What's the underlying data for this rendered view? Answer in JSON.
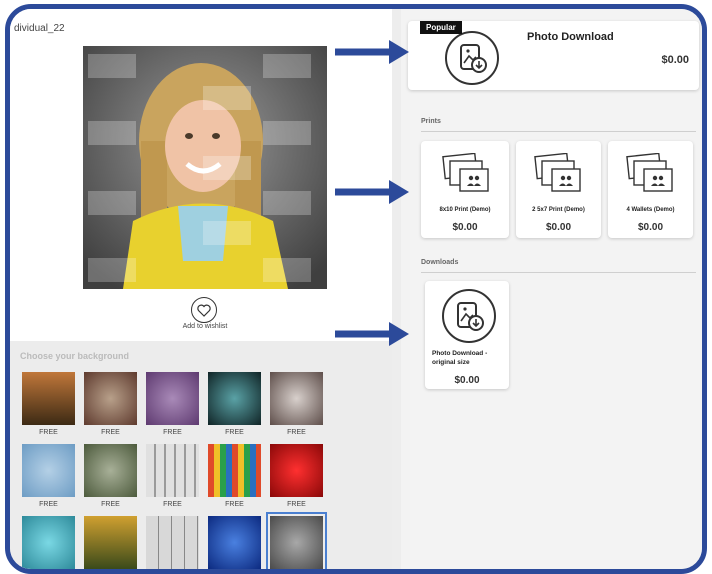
{
  "file_name": "dividual_22",
  "wishlist_label": "Add to wishlist",
  "background_section_title": "Choose your background",
  "backgrounds": [
    {
      "label": "FREE",
      "color": "#6b4a2a"
    },
    {
      "label": "FREE",
      "color": "#8a6b60"
    },
    {
      "label": "FREE",
      "color": "#7a5a8e"
    },
    {
      "label": "FREE",
      "color": "#2e5a5e"
    },
    {
      "label": "FREE",
      "color": "#8a7d7a"
    },
    {
      "label": "FREE",
      "color": "#8fb6d4"
    },
    {
      "label": "FREE",
      "color": "#7c8870"
    },
    {
      "label": "FREE",
      "color": "#c8c8c8"
    },
    {
      "label": "FREE",
      "color": "#c8672e"
    },
    {
      "label": "FREE",
      "color": "#c01a1a"
    },
    {
      "label": "",
      "color": "#4fb3c4"
    },
    {
      "label": "",
      "color": "#6a6a32"
    },
    {
      "label": "",
      "color": "#bfbfbf"
    },
    {
      "label": "",
      "color": "#1f47a8"
    },
    {
      "label": "",
      "color": "#7a7a7a"
    }
  ],
  "featured": {
    "badge": "Popular",
    "title": "Photo Download",
    "price": "$0.00"
  },
  "sections": {
    "prints": "Prints",
    "downloads": "Downloads"
  },
  "prints": [
    {
      "name": "8x10 Print (Demo)",
      "price": "$0.00"
    },
    {
      "name": "2 5x7 Print (Demo)",
      "price": "$0.00"
    },
    {
      "name": "4 Wallets (Demo)",
      "price": "$0.00"
    }
  ],
  "downloads": [
    {
      "name": "Photo Download - original size",
      "price": "$0.00"
    }
  ],
  "colors": {
    "frame": "#2c4a9a",
    "arrow": "#2c4a9a"
  }
}
